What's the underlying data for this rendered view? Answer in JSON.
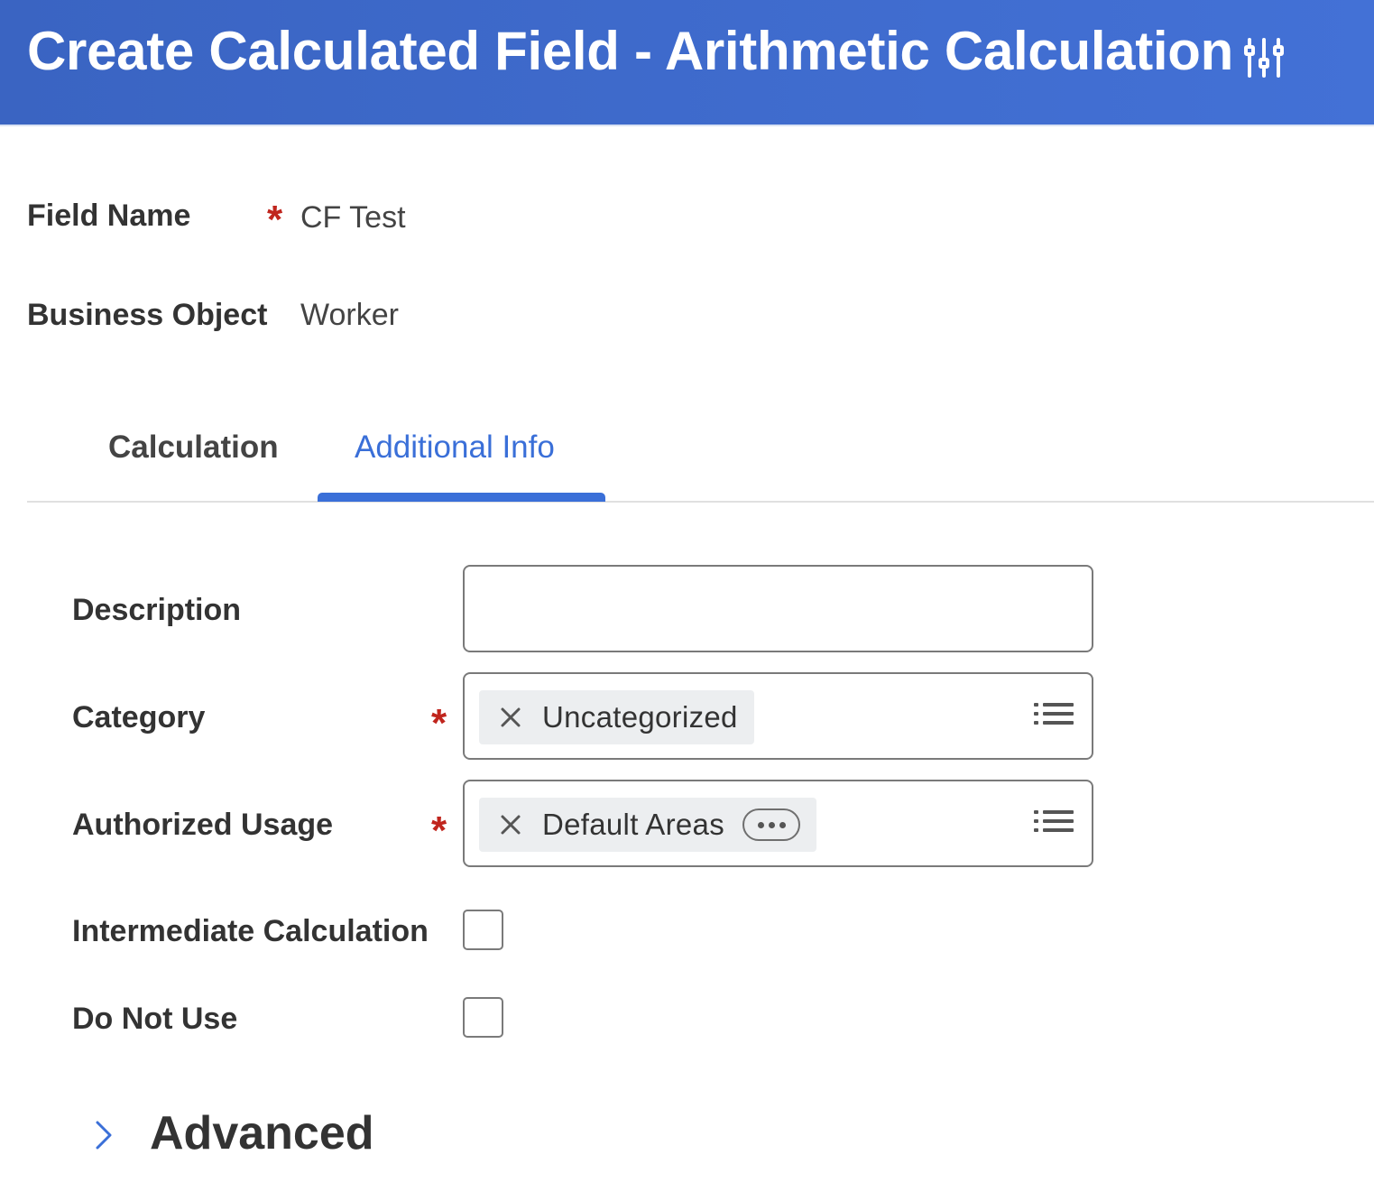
{
  "header": {
    "title": "Create Calculated Field - Arithmetic Calculation",
    "settings_icon": "related-actions-sliders-icon",
    "background_color": "#3f6bcd"
  },
  "summary": {
    "field_name_label": "Field Name",
    "field_name_value": "CF Test",
    "field_name_required": true,
    "business_object_label": "Business Object",
    "business_object_value": "Worker"
  },
  "tabs": [
    {
      "label": "Calculation",
      "active": false
    },
    {
      "label": "Additional Info",
      "active": true
    }
  ],
  "form": {
    "description": {
      "label": "Description",
      "value": ""
    },
    "category": {
      "label": "Category",
      "required": true,
      "selected": "Uncategorized",
      "remove_icon": "close-icon",
      "prompt_icon": "list-icon"
    },
    "authorized_usage": {
      "label": "Authorized Usage",
      "required": true,
      "selected": "Default Areas",
      "remove_icon": "close-icon",
      "more_icon": "more-ellipsis-icon",
      "prompt_icon": "list-icon"
    },
    "intermediate_calculation": {
      "label": "Intermediate Calculation",
      "checked": false
    },
    "do_not_use": {
      "label": "Do Not Use",
      "checked": false
    }
  },
  "advanced": {
    "label": "Advanced",
    "expanded": false,
    "icon": "chevron-right-icon"
  },
  "colors": {
    "accent": "#3a6fd8",
    "required": "#c0251d"
  }
}
